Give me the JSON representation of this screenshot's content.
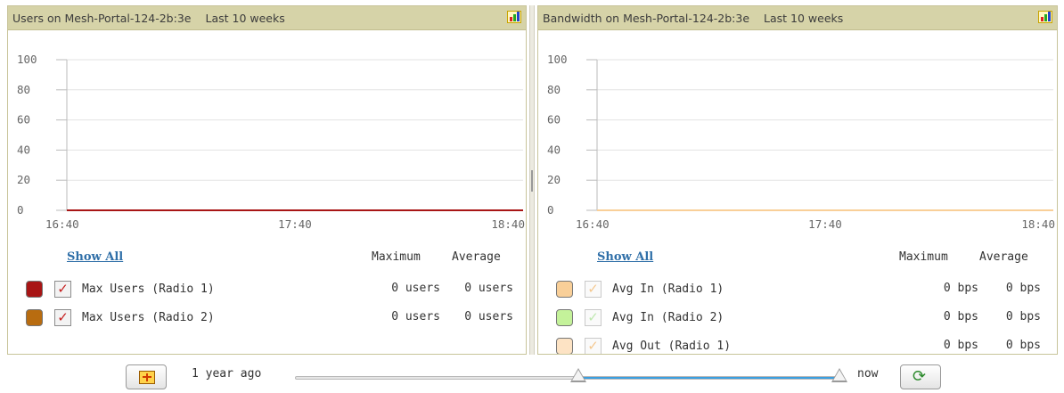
{
  "users_panel": {
    "title": "Users on Mesh-Portal-124-2b:3e",
    "range": "Last 10 weeks",
    "show_all": "Show All",
    "col_max": "Maximum",
    "col_avg": "Average",
    "series": [
      {
        "name": "Max Users (Radio 1)",
        "max": "0 users",
        "avg": "0 users",
        "color": "#a81515",
        "checked": true
      },
      {
        "name": "Max Users (Radio 2)",
        "max": "0 users",
        "avg": "0 users",
        "color": "#b86c10",
        "checked": true
      }
    ]
  },
  "bandwidth_panel": {
    "title": "Bandwidth on Mesh-Portal-124-2b:3e",
    "range": "Last 10 weeks",
    "show_all": "Show All",
    "col_max": "Maximum",
    "col_avg": "Average",
    "series": [
      {
        "name": "Avg In (Radio 1)",
        "max": "0 bps",
        "avg": "0 bps",
        "color": "#f9cf98",
        "checked": false
      },
      {
        "name": "Avg In (Radio 2)",
        "max": "0 bps",
        "avg": "0 bps",
        "color": "#c4f29a",
        "checked": false
      },
      {
        "name": "Avg Out (Radio 1)",
        "max": "0 bps",
        "avg": "0 bps",
        "color": "#fde3c4",
        "checked": false
      }
    ]
  },
  "timeline": {
    "start_label": "1 year ago",
    "end_label": "now",
    "selection_start": 0.52,
    "selection_end": 1.0
  },
  "chart_data": [
    {
      "type": "line",
      "title": "Users on Mesh-Portal-124-2b:3e",
      "subtitle": "Last 10 weeks",
      "x": [
        "16:40",
        "17:40",
        "18:40"
      ],
      "ylim": [
        0,
        100
      ],
      "yticks": [
        0,
        20,
        40,
        60,
        80,
        100
      ],
      "grid": true,
      "series": [
        {
          "name": "Max Users (Radio 1)",
          "color": "#a81515",
          "values": [
            0,
            0,
            0
          ]
        },
        {
          "name": "Max Users (Radio 2)",
          "color": "#b86c10",
          "values": [
            0,
            0,
            0
          ]
        }
      ]
    },
    {
      "type": "line",
      "title": "Bandwidth on Mesh-Portal-124-2b:3e",
      "subtitle": "Last 10 weeks",
      "x": [
        "16:40",
        "17:40",
        "18:40"
      ],
      "ylim": [
        0,
        100
      ],
      "yticks": [
        0,
        20,
        40,
        60,
        80,
        100
      ],
      "grid": true,
      "series": [
        {
          "name": "Avg In (Radio 1)",
          "color": "#f9cf98",
          "values": [
            0,
            0,
            0
          ]
        },
        {
          "name": "Avg In (Radio 2)",
          "color": "#c4f29a",
          "values": [
            0,
            0,
            0
          ]
        },
        {
          "name": "Avg Out (Radio 1)",
          "color": "#fde3c4",
          "values": [
            0,
            0,
            0
          ]
        }
      ]
    }
  ]
}
